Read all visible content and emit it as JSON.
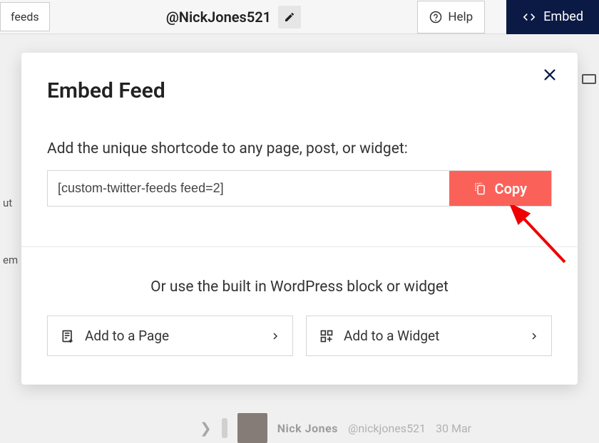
{
  "topbar": {
    "feeds_label": "feeds",
    "feed_name": "@NickJones521",
    "help_label": "Help",
    "embed_label": "Embed"
  },
  "side": {
    "item1": "ut",
    "item2": "em"
  },
  "blur": {
    "name": "Nick Jones",
    "handle": "@nickjones521",
    "date": "30 Mar"
  },
  "modal": {
    "title": "Embed Feed",
    "subtitle": "Add the unique shortcode to any page, post, or widget:",
    "shortcode": "[custom-twitter-feeds feed=2]",
    "copy_label": "Copy",
    "or_text": "Or use the built in WordPress block or widget",
    "add_page_label": "Add to a Page",
    "add_widget_label": "Add to a Widget"
  }
}
